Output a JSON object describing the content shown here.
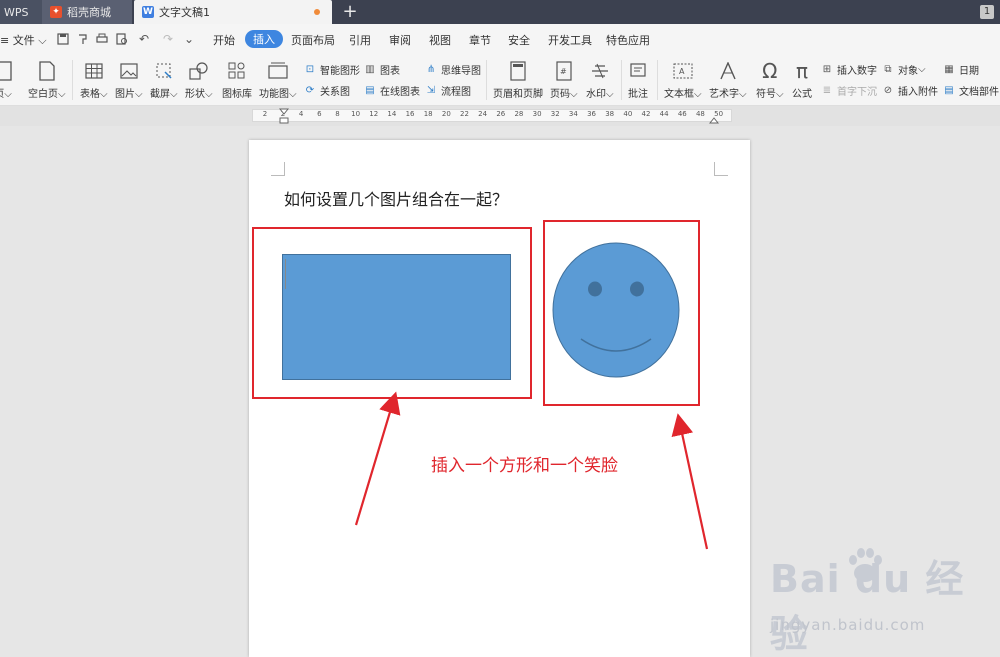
{
  "tabs": {
    "wps": "WPS",
    "store": "稻壳商城",
    "doc": "文字文稿1",
    "page_badge": "1"
  },
  "menu": {
    "file": "文件",
    "items": [
      "开始",
      "插入",
      "页面布局",
      "引用",
      "审阅",
      "视图",
      "章节",
      "安全",
      "开发工具",
      "特色应用"
    ],
    "active": "插入"
  },
  "ribbon": {
    "page_partial": "页",
    "blank_page": "空白页",
    "table": "表格",
    "picture": "图片",
    "screenshot": "截屏",
    "shape": "形状",
    "icon_lib": "图标库",
    "function_chart": "功能图",
    "smart_shape": "智能图形",
    "chart": "图表",
    "mindmap": "思维导图",
    "relation": "关系图",
    "online_chart": "在线图表",
    "flowchart": "流程图",
    "header_footer": "页眉和页脚",
    "page_number": "页码",
    "watermark": "水印",
    "comment": "批注",
    "textbox": "文本框",
    "wordart": "艺术字",
    "symbol": "符号",
    "formula": "公式",
    "insert_number": "插入数字",
    "drop_cap": "首字下沉",
    "object": "对象",
    "attachment": "插入附件",
    "date": "日期",
    "doc_part": "文档部件"
  },
  "ruler": {
    "ticks": [
      "2",
      "2",
      "4",
      "6",
      "8",
      "10",
      "12",
      "14",
      "16",
      "18",
      "20",
      "22",
      "24",
      "26",
      "28",
      "30",
      "32",
      "34",
      "36",
      "38",
      "40",
      "42",
      "44",
      "46",
      "48",
      "50"
    ]
  },
  "document": {
    "title": "如何设置几个图片组合在一起？",
    "annotation": "插入一个方形和一个笑脸"
  },
  "colors": {
    "shape_fill": "#5b9bd5",
    "shape_stroke": "#41719c",
    "annotation_red": "#e0262d",
    "active_tab": "#3e86e0"
  },
  "watermark": {
    "brand": "Bai du 经验",
    "url": "jingyan.baidu.com"
  }
}
